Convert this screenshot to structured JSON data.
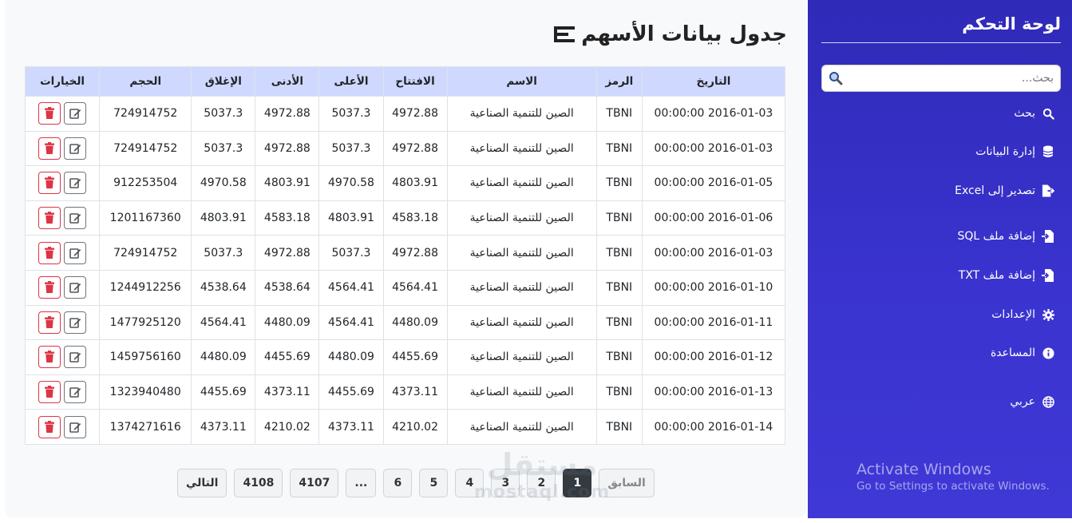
{
  "page": {
    "title": "جدول بيانات الأسهم"
  },
  "table": {
    "headers": {
      "date": "التاريخ",
      "symbol": "الرمز",
      "name": "الاسم",
      "open": "الافتتاح",
      "high": "الأعلى",
      "low": "الأدنى",
      "close": "الإغلاق",
      "volume": "الحجم",
      "options": "الخيارات"
    },
    "rows": [
      {
        "date": "2016-01-03 00:00:00",
        "symbol": "TBNI",
        "name": "الصين للتنمية الصناعية",
        "open": "4972.88",
        "high": "5037.3",
        "low": "4972.88",
        "close": "5037.3",
        "volume": "724914752"
      },
      {
        "date": "2016-01-03 00:00:00",
        "symbol": "TBNI",
        "name": "الصين للتنمية الصناعية",
        "open": "4972.88",
        "high": "5037.3",
        "low": "4972.88",
        "close": "5037.3",
        "volume": "724914752"
      },
      {
        "date": "2016-01-05 00:00:00",
        "symbol": "TBNI",
        "name": "الصين للتنمية الصناعية",
        "open": "4803.91",
        "high": "4970.58",
        "low": "4803.91",
        "close": "4970.58",
        "volume": "912253504"
      },
      {
        "date": "2016-01-06 00:00:00",
        "symbol": "TBNI",
        "name": "الصين للتنمية الصناعية",
        "open": "4583.18",
        "high": "4803.91",
        "low": "4583.18",
        "close": "4803.91",
        "volume": "1201167360"
      },
      {
        "date": "2016-01-03 00:00:00",
        "symbol": "TBNI",
        "name": "الصين للتنمية الصناعية",
        "open": "4972.88",
        "high": "5037.3",
        "low": "4972.88",
        "close": "5037.3",
        "volume": "724914752"
      },
      {
        "date": "2016-01-10 00:00:00",
        "symbol": "TBNI",
        "name": "الصين للتنمية الصناعية",
        "open": "4564.41",
        "high": "4564.41",
        "low": "4538.64",
        "close": "4538.64",
        "volume": "1244912256"
      },
      {
        "date": "2016-01-11 00:00:00",
        "symbol": "TBNI",
        "name": "الصين للتنمية الصناعية",
        "open": "4480.09",
        "high": "4564.41",
        "low": "4480.09",
        "close": "4564.41",
        "volume": "1477925120"
      },
      {
        "date": "2016-01-12 00:00:00",
        "symbol": "TBNI",
        "name": "الصين للتنمية الصناعية",
        "open": "4455.69",
        "high": "4480.09",
        "low": "4455.69",
        "close": "4480.09",
        "volume": "1459756160"
      },
      {
        "date": "2016-01-13 00:00:00",
        "symbol": "TBNI",
        "name": "الصين للتنمية الصناعية",
        "open": "4373.11",
        "high": "4455.69",
        "low": "4373.11",
        "close": "4455.69",
        "volume": "1323940480"
      },
      {
        "date": "2016-01-14 00:00:00",
        "symbol": "TBNI",
        "name": "الصين للتنمية الصناعية",
        "open": "4210.02",
        "high": "4373.11",
        "low": "4210.02",
        "close": "4373.11",
        "volume": "1374271616"
      }
    ],
    "row_actions": {
      "edit_icon": "edit-icon",
      "delete_icon": "trash-icon"
    }
  },
  "pagination": {
    "items": [
      {
        "label": "التالي",
        "kind": "next",
        "wide": true
      },
      {
        "label": "4108",
        "kind": "page",
        "wide": true
      },
      {
        "label": "4107",
        "kind": "page",
        "wide": true
      },
      {
        "label": "...",
        "kind": "ellipsis",
        "wide": false
      },
      {
        "label": "6",
        "kind": "page",
        "wide": false
      },
      {
        "label": "5",
        "kind": "page",
        "wide": false
      },
      {
        "label": "4",
        "kind": "page",
        "wide": false
      },
      {
        "label": "3",
        "kind": "page",
        "wide": false
      },
      {
        "label": "2",
        "kind": "page",
        "wide": false
      },
      {
        "label": "1",
        "kind": "active",
        "wide": false
      },
      {
        "label": "السابق",
        "kind": "prev",
        "wide": true
      }
    ]
  },
  "watermark": {
    "arabic": "مستقل",
    "latin": "mostaql.com"
  },
  "sidebar": {
    "title": "لوحة التحكم",
    "search_placeholder": "بحث...",
    "items": [
      {
        "label": "بحث",
        "icon": "search-icon"
      },
      {
        "label": "إدارة البيانات",
        "icon": "database-icon"
      },
      {
        "label": "تصدير إلى Excel",
        "icon": "file-export-icon"
      },
      {
        "label": "إضافة ملف SQL",
        "icon": "file-import-icon"
      },
      {
        "label": "إضافة ملف TXT",
        "icon": "file-import-icon"
      },
      {
        "label": "الإعدادات",
        "icon": "gear-icon"
      },
      {
        "label": "المساعدة",
        "icon": "info-icon"
      },
      {
        "label": "عربي",
        "icon": "globe-icon"
      }
    ]
  },
  "os_overlay": {
    "line1": "Activate Windows",
    "line2": "Go to Settings to activate Windows."
  },
  "colors": {
    "table_header_bg": "#cfd9ff",
    "sidebar_bg": "#3a33cf",
    "delete_red": "#dc3545",
    "active_page": "#343a40"
  }
}
